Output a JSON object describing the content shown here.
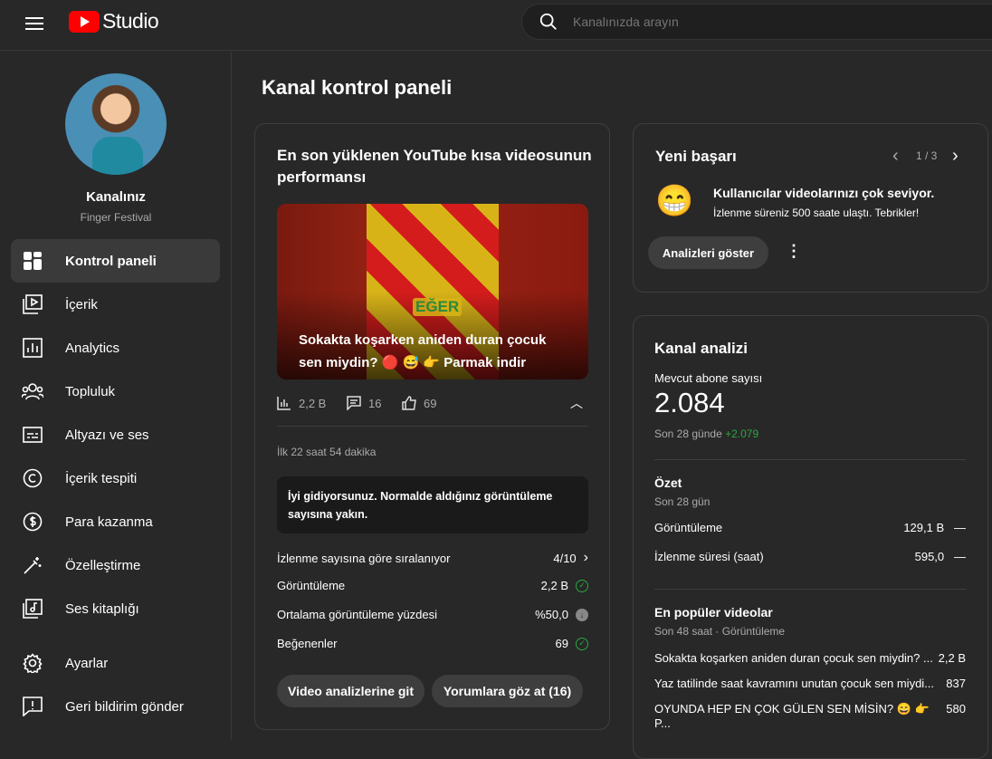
{
  "header": {
    "logo_text": "Studio",
    "search_placeholder": "Kanalınızda arayın"
  },
  "sidebar": {
    "channel_title": "Kanalınız",
    "channel_name": "Finger Festival",
    "items": [
      {
        "label": "Kontrol paneli",
        "icon": "dashboard-icon"
      },
      {
        "label": "İçerik",
        "icon": "content-icon"
      },
      {
        "label": "Analytics",
        "icon": "analytics-icon"
      },
      {
        "label": "Topluluk",
        "icon": "community-icon"
      },
      {
        "label": "Altyazı ve ses",
        "icon": "subtitles-icon"
      },
      {
        "label": "İçerik tespiti",
        "icon": "copyright-icon"
      },
      {
        "label": "Para kazanma",
        "icon": "dollar-icon"
      },
      {
        "label": "Özelleştirme",
        "icon": "magic-wand-icon"
      },
      {
        "label": "Ses kitaplığı",
        "icon": "audio-library-icon"
      },
      {
        "label": "Ayarlar",
        "icon": "gear-icon"
      },
      {
        "label": "Geri bildirim gönder",
        "icon": "feedback-icon"
      }
    ]
  },
  "page_title": "Kanal kontrol paneli",
  "latest_short": {
    "title": "En son yüklenen YouTube kısa videosunun performansı",
    "thumb_overlay": "EĞER",
    "video_title": "Sokakta koşarken aniden duran çocuk sen miydin? 🔴 😅 👉 Parmak indir",
    "views": "2,2 B",
    "comments": "16",
    "likes": "69",
    "period": "İlk 22 saat 54 dakika",
    "message": "İyi gidiyorsunuz. Normalde aldığınız görüntüleme sayısına yakın.",
    "stats": [
      {
        "label": "İzlenme sayısına göre sıralanıyor",
        "value": "4/10",
        "status": "chevron"
      },
      {
        "label": "Görüntüleme",
        "value": "2,2 B",
        "status": "check"
      },
      {
        "label": "Ortalama görüntüleme yüzdesi",
        "value": "%50,0",
        "status": "down"
      },
      {
        "label": "Beğenenler",
        "value": "69",
        "status": "check"
      }
    ],
    "btn_analytics": "Video analizlerine git",
    "btn_comments": "Yorumlara göz at (16)"
  },
  "achievement": {
    "title": "Yeni başarı",
    "pager": "1 / 3",
    "emoji": "😁",
    "headline": "Kullanıcılar videolarınızı çok seviyor.",
    "detail": "İzlenme süreniz 500 saate ulaştı. Tebrikler!",
    "button": "Analizleri göster"
  },
  "analytics": {
    "title": "Kanal analizi",
    "subs_label": "Mevcut abone sayısı",
    "subs": "2.084",
    "subs_period": "Son 28 günde",
    "subs_delta": "+2.079",
    "delta_color": "#2ba640",
    "summary_title": "Özet",
    "summary_period": "Son 28 gün",
    "summary": [
      {
        "label": "Görüntüleme",
        "value": "129,1 B",
        "trend": "—"
      },
      {
        "label": "İzlenme süresi (saat)",
        "value": "595,0",
        "trend": "—"
      }
    ],
    "top_title": "En popüler videolar",
    "top_period": "Son 48 saat · Görüntüleme",
    "top": [
      {
        "title": "Sokakta koşarken aniden duran çocuk sen miydin? ...",
        "views": "2,2 B"
      },
      {
        "title": "Yaz tatilinde saat kavramını unutan çocuk sen miydi...",
        "views": "837"
      },
      {
        "title": "OYUNDA HEP EN ÇOK GÜLEN SEN MİSİN? 😄 👉 P...",
        "views": "580"
      }
    ]
  }
}
